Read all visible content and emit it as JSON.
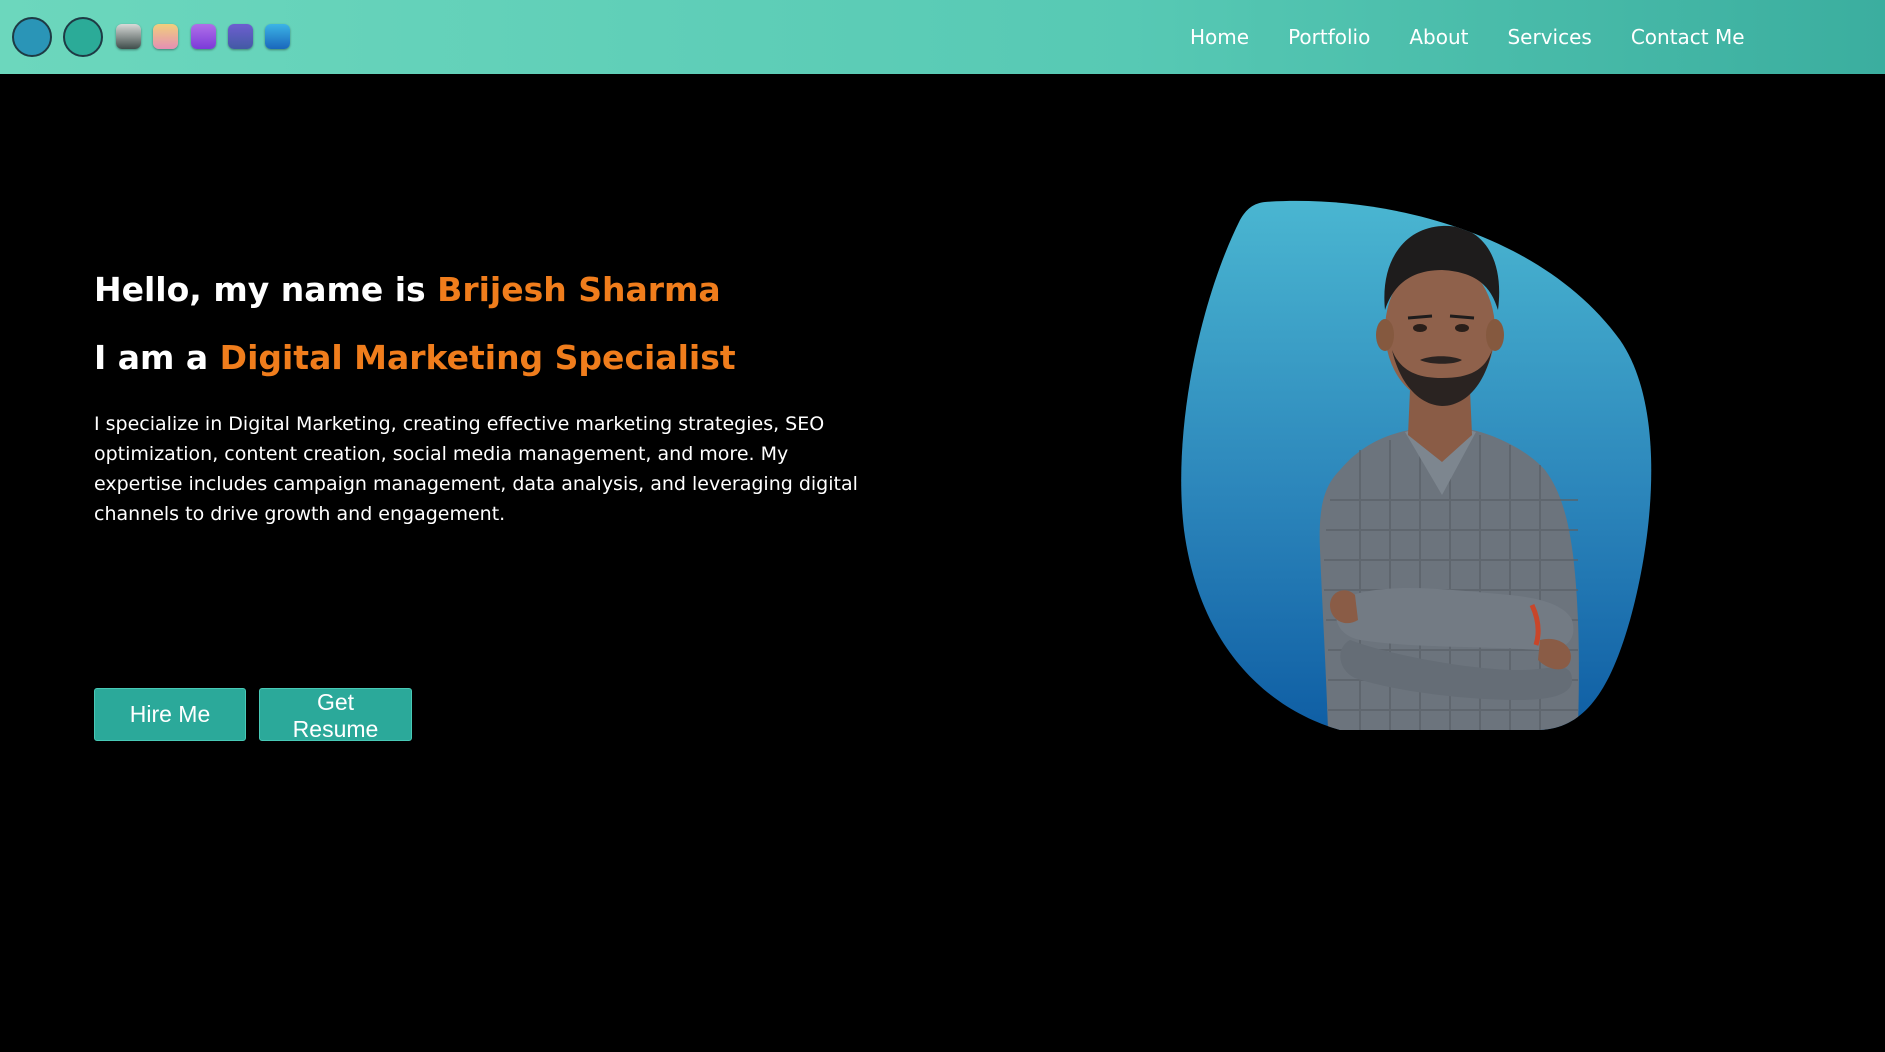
{
  "header": {
    "theme_circles": [
      "theme-blue",
      "theme-teal"
    ],
    "swatches": [
      "gray-gradient",
      "peach-pink-gradient",
      "purple-gradient",
      "indigo-gradient",
      "blue-gradient"
    ],
    "nav": [
      {
        "label": "Home"
      },
      {
        "label": "Portfolio"
      },
      {
        "label": "About"
      },
      {
        "label": "Services"
      },
      {
        "label": "Contact Me"
      }
    ]
  },
  "hero": {
    "greeting_prefix": "Hello, my name is ",
    "name": "Brijesh Sharma",
    "role_prefix": "I am a ",
    "role": "Digital Marketing Specialist",
    "description": "I specialize in Digital Marketing, creating effective marketing strategies, SEO optimization, content creation, social media management, and more. My expertise includes campaign management, data analysis, and leveraging digital channels to drive growth and engagement.",
    "buttons": {
      "hire": "Hire Me",
      "resume": "Get Resume"
    }
  },
  "colors": {
    "accent": "#f07d1c",
    "primary": "#2ba99a",
    "background": "#000000",
    "navbar": "#57c9b4"
  },
  "icons": {
    "portrait": "person-photo"
  }
}
